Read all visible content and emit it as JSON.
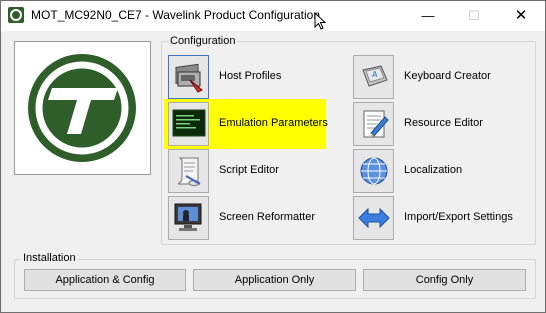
{
  "window": {
    "title": "MOT_MC92N0_CE7 - Wavelink Product Configuration",
    "minimize_glyph": "—",
    "maximize_glyph": "☐",
    "close_glyph": "✕"
  },
  "configuration": {
    "label": "Configuration",
    "items": [
      {
        "label": "Host Profiles",
        "icon": "host-profiles-icon"
      },
      {
        "label": "Emulation Parameters",
        "icon": "emulation-terminal-icon",
        "highlighted": true
      },
      {
        "label": "Script Editor",
        "icon": "scroll-icon"
      },
      {
        "label": "Screen Reformatter",
        "icon": "monitor-icon"
      },
      {
        "label": "Keyboard Creator",
        "icon": "keyboard-key-icon"
      },
      {
        "label": "Resource Editor",
        "icon": "document-edit-icon"
      },
      {
        "label": "Localization",
        "icon": "globe-icon"
      },
      {
        "label": "Import/Export Settings",
        "icon": "double-arrow-icon"
      }
    ]
  },
  "installation": {
    "label": "Installation",
    "buttons": [
      {
        "label": "Application & Config"
      },
      {
        "label": "Application Only"
      },
      {
        "label": "Config Only"
      }
    ]
  },
  "colors": {
    "brand_green": "#2f5e2a",
    "highlight": "#ffff00",
    "window_bg": "#f0f0f0"
  }
}
